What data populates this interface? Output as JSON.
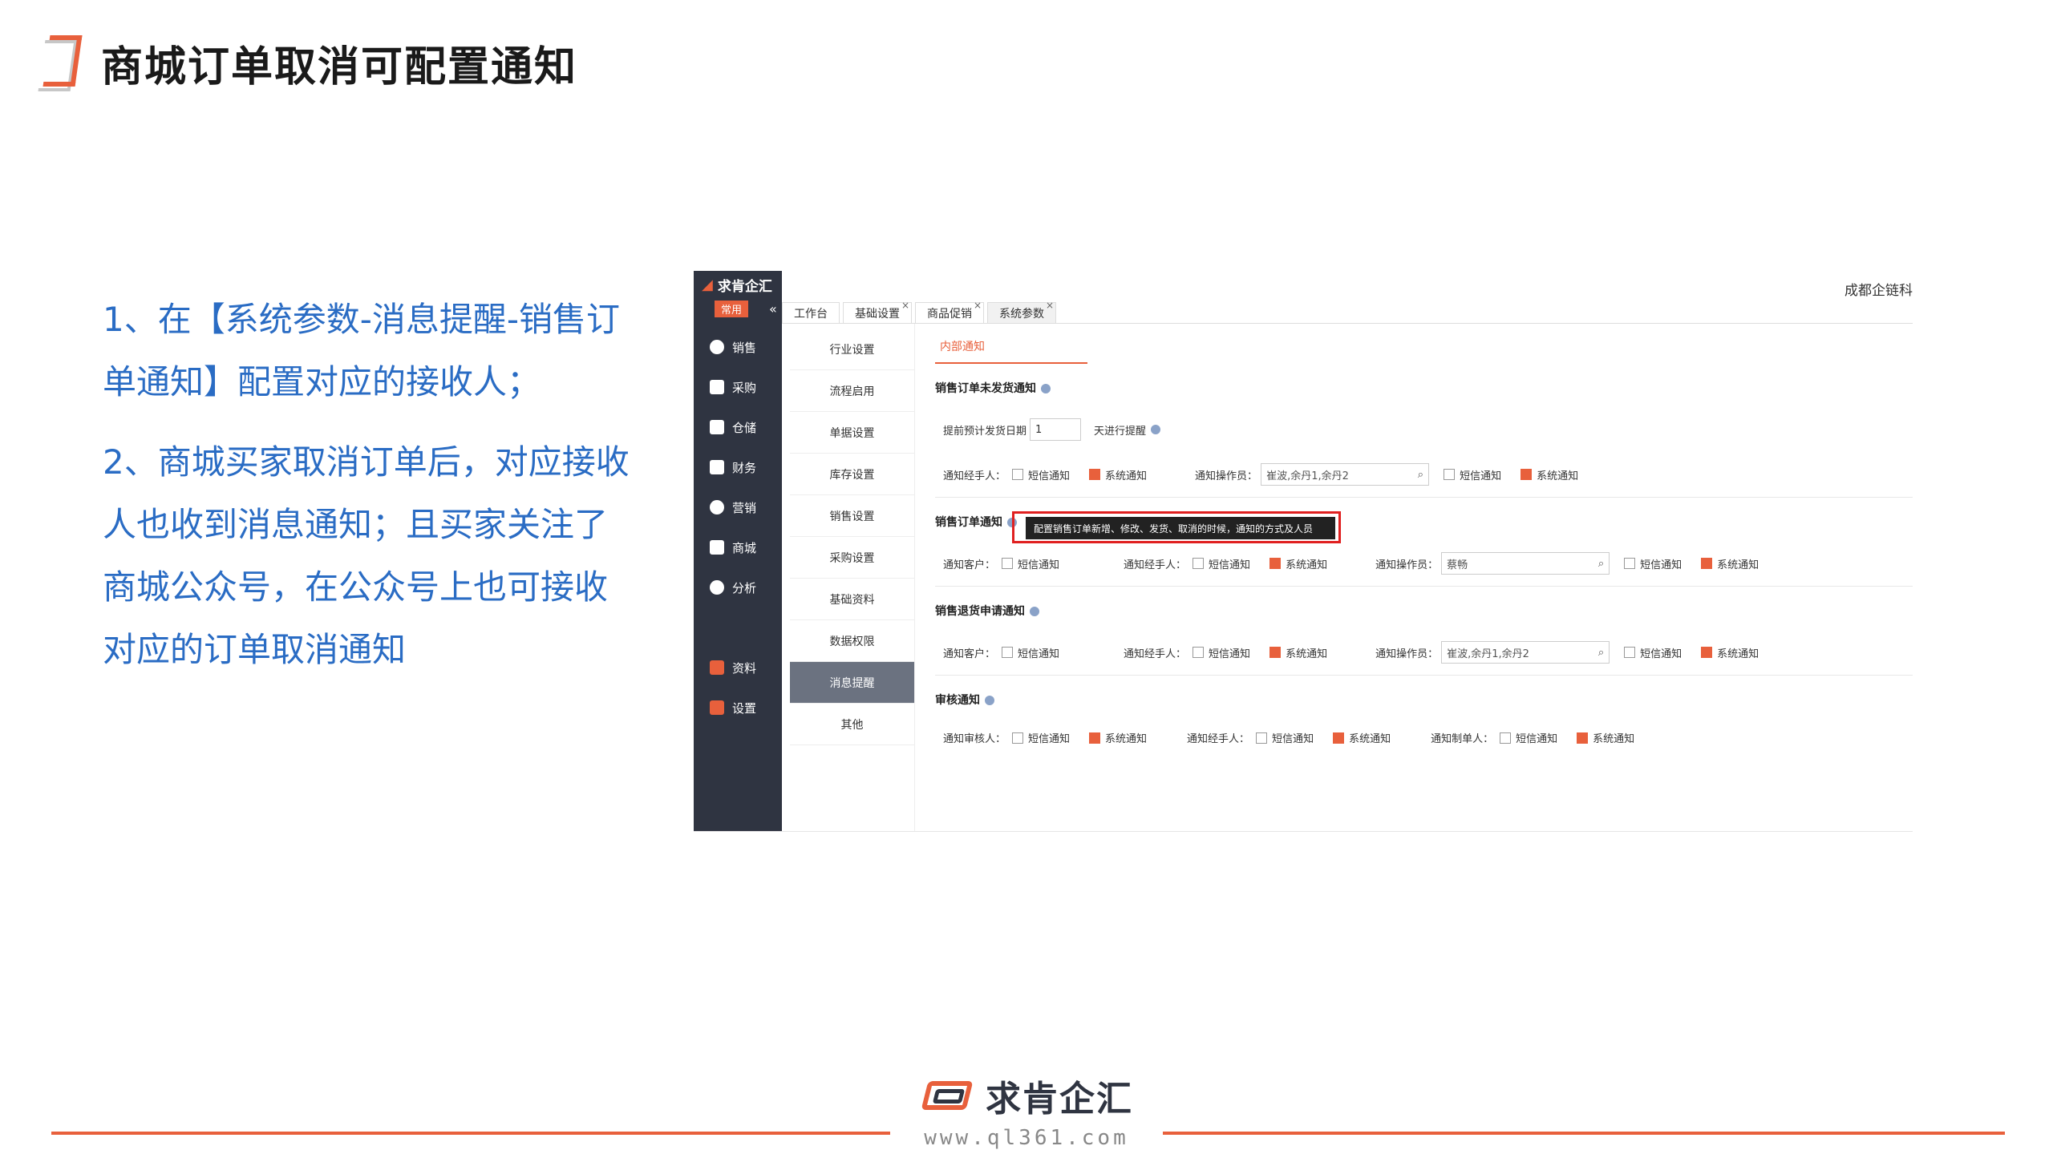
{
  "title": "商城订单取消可配置通知",
  "description": [
    "1、在【系统参数-消息提醒-销售订单通知】配置对应的接收人；",
    "2、商城买家取消订单后，对应接收人也收到消息通知；且买家关注了商城公众号，在公众号上也可接收对应的订单取消通知"
  ],
  "app": {
    "logo": "求肯企汇",
    "common_tag": "常用",
    "collapse": "«",
    "company": "成都企链科",
    "nav": [
      "销售",
      "采购",
      "仓储",
      "财务",
      "营销",
      "商城",
      "分析"
    ],
    "nav_bottom": [
      "资料",
      "设置"
    ],
    "tabs": [
      {
        "label": "工作台",
        "close": ""
      },
      {
        "label": "基础设置",
        "close": "×"
      },
      {
        "label": "商品促销",
        "close": "×"
      },
      {
        "label": "系统参数",
        "close": "×"
      }
    ],
    "sub_menu": [
      "行业设置",
      "流程启用",
      "单据设置",
      "库存设置",
      "销售设置",
      "采购设置",
      "基础资料",
      "数据权限",
      "消息提醒",
      "其他"
    ],
    "inner_tab": "内部通知",
    "sections": {
      "unshipped": {
        "title": "销售订单未发货通知",
        "days_label_before": "提前预计发货日期",
        "days_value": "1",
        "days_label_after": "天进行提醒",
        "handler_label": "通知经手人：",
        "operator_label": "通知操作员：",
        "operator_value": "崔波,余丹1,余丹2"
      },
      "order": {
        "title": "销售订单通知",
        "customer_label": "通知客户：",
        "handler_label": "通知经手人：",
        "operator_label": "通知操作员：",
        "operator_value": "蔡畅"
      },
      "return": {
        "title": "销售退货申请通知",
        "customer_label": "通知客户：",
        "handler_label": "通知经手人：",
        "operator_label": "通知操作员：",
        "operator_value": "崔波,余丹1,余丹2"
      },
      "audit": {
        "title": "审核通知",
        "auditor_label": "通知审核人：",
        "handler_label": "通知经手人：",
        "creator_label": "通知制单人："
      }
    },
    "sms": "短信通知",
    "sys": "系统通知",
    "tooltip": "配置销售订单新增、修改、发货、取消的时候，通知的方式及人员"
  },
  "footer": {
    "brand": "求肯企汇",
    "url": "www.ql361.com"
  },
  "colors": {
    "accent": "#e8603c",
    "text_blue": "#2a6cc4",
    "sidebar": "#2f3441"
  }
}
